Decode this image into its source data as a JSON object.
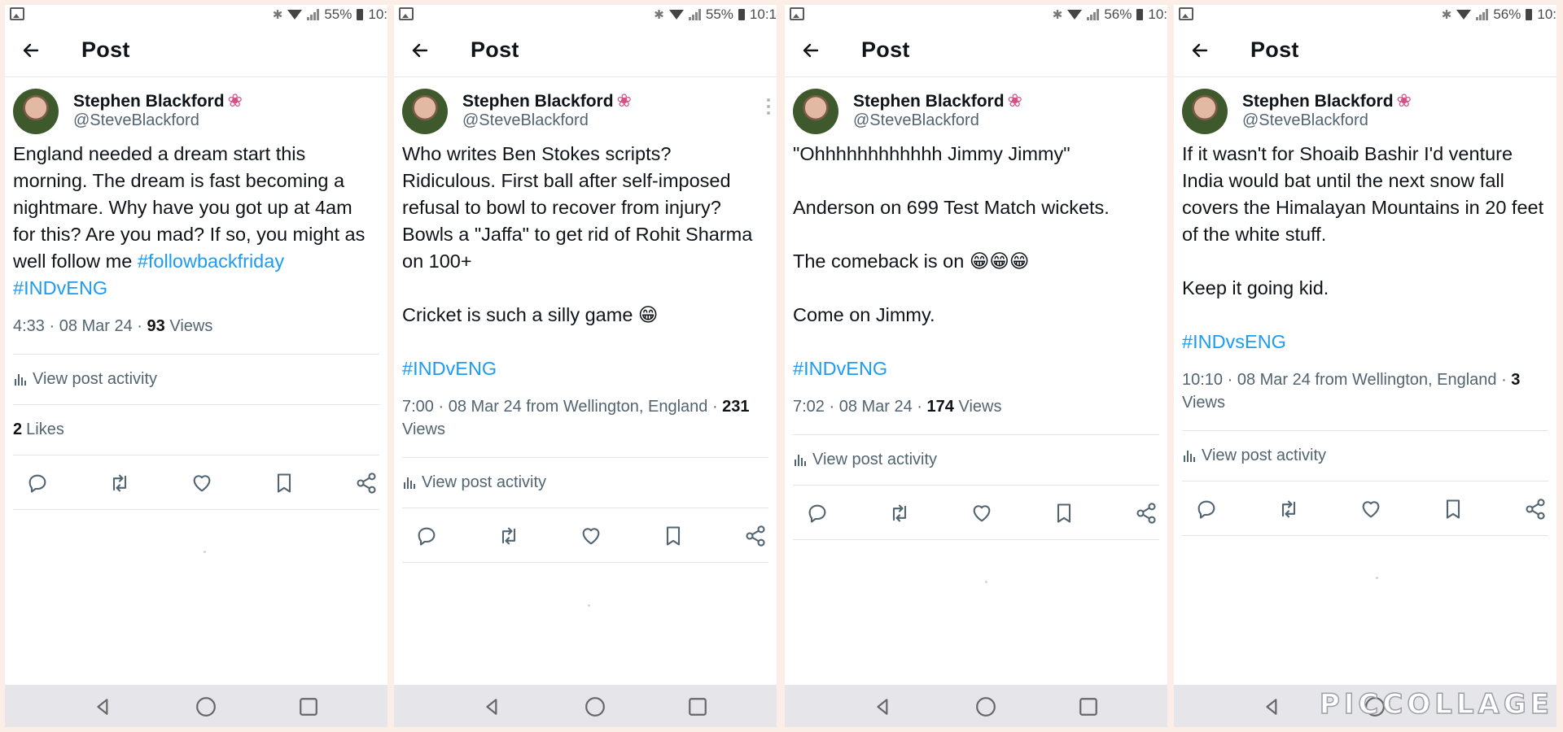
{
  "posts": [
    {
      "status": {
        "battery": "55%",
        "time": "10:"
      },
      "title": "Post",
      "author": {
        "name": "Stephen Blackford",
        "handle": "@SteveBlackford"
      },
      "text": "England needed a dream start this morning. The dream is fast becoming a nightmare. Why have you got up at 4am for this? Are you mad? If so, you might as well follow me",
      "hashtags": "#followbackfriday\n#INDvENG",
      "meta_prefix": "4:33 · 08 Mar 24 · ",
      "views": "93",
      "views_label": " Views",
      "activity": "View post activity",
      "likes_count": "2",
      "likes_label": "Likes"
    },
    {
      "status": {
        "battery": "55%",
        "time": "10:1"
      },
      "title": "Post",
      "author": {
        "name": "Stephen Blackford",
        "handle": "@SteveBlackford"
      },
      "text": "Who writes Ben Stokes scripts? Ridiculous. First ball after self-imposed refusal to bowl to recover from injury? Bowls a \"Jaffa\" to get rid of Rohit Sharma on 100+\n\nCricket is such a silly game 😁",
      "hashtags": "#INDvENG",
      "meta_prefix": "7:00 · 08 Mar 24 from Wellington, England · ",
      "views": "231",
      "views_label": " Views",
      "activity": "View post activity"
    },
    {
      "status": {
        "battery": "56%",
        "time": "10:"
      },
      "title": "Post",
      "author": {
        "name": "Stephen Blackford",
        "handle": "@SteveBlackford"
      },
      "text": "\"Ohhhhhhhhhhhh Jimmy Jimmy\"\n\nAnderson on 699 Test Match wickets.\n\nThe comeback is on 😁😁😁\n\nCome on Jimmy.",
      "hashtags": "#INDvENG",
      "meta_prefix": "7:02 · 08 Mar 24 · ",
      "views": "174",
      "views_label": " Views",
      "activity": "View post activity"
    },
    {
      "status": {
        "battery": "56%",
        "time": "10:"
      },
      "title": "Post",
      "author": {
        "name": "Stephen Blackford",
        "handle": "@SteveBlackford"
      },
      "text": "If it wasn't for Shoaib Bashir I'd venture India would bat until the next snow fall covers the Himalayan Mountains in 20 feet of the white stuff.\n\nKeep it going kid.",
      "hashtags": "#INDvsENG",
      "meta_prefix": "10:10 · 08 Mar 24 from Wellington, England · ",
      "views": "3",
      "views_label": " Views",
      "activity": "View post activity"
    }
  ],
  "watermark": "PICCOLLAGE",
  "icons": [
    "back-arrow-icon",
    "reply-icon",
    "repost-icon",
    "like-icon",
    "bookmark-icon",
    "share-icon",
    "flower-icon",
    "back-nav-icon",
    "home-nav-icon",
    "recents-nav-icon"
  ],
  "colors": {
    "link": "#1d9bf0",
    "text": "#0f1419",
    "muted": "#536471",
    "flower": "#d64f86"
  }
}
